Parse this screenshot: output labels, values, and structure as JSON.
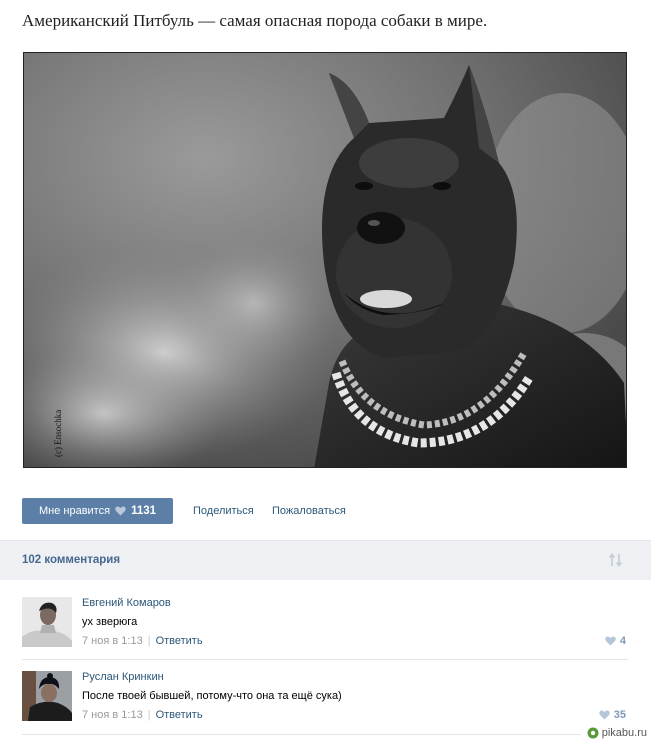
{
  "post": {
    "title": "Американский Питбуль — самая опасная порода собаки в мире.",
    "photo_credit": "(c) Ensochka"
  },
  "actions": {
    "like_label": "Мне нравится",
    "like_count": "1131",
    "share_label": "Поделиться",
    "report_label": "Пожаловаться"
  },
  "comments_header": {
    "count_label": "102 комментария"
  },
  "comments": [
    {
      "author": "Евгений Комаров",
      "text": "ух зверюга",
      "date": "7 ноя в 1:13",
      "reply_label": "Ответить",
      "likes": "4"
    },
    {
      "author": "Руслан Кринкин",
      "text": "После твоей бывшей, потому-что она та ещё сука)",
      "date": "7 ноя в 1:13",
      "reply_label": "Ответить",
      "likes": "35"
    }
  ],
  "watermark": {
    "text": "pikabu.ru"
  },
  "colors": {
    "accent": "#5b7fa6",
    "link": "#2b587a",
    "bar_bg": "#eef0f3"
  }
}
